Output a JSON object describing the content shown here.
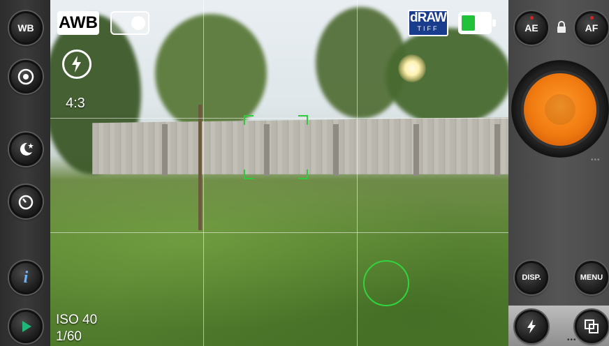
{
  "left_toolbar": {
    "white_balance_label": "WB"
  },
  "overlays": {
    "awb_label": "AWB",
    "aspect_ratio": "4:3",
    "iso_label": "ISO 40",
    "shutter_speed": "1/60"
  },
  "badges": {
    "draw_label": "dRAW",
    "tiff_label": "TIFF",
    "battery_level_percent": 50,
    "battery_color": "#21c23a"
  },
  "right_toolbar": {
    "ae_label": "AE",
    "af_label": "AF",
    "disp_label": "DISP.",
    "menu_label": "MENU"
  },
  "colors": {
    "shutter": "#f07a10",
    "focus": "#2ecb3c",
    "awb_background": "#ffffff",
    "draw_badge": "#1a3c8c"
  },
  "icons": [
    "flash-auto-icon",
    "flash-off-icon",
    "stabilizer-icon",
    "night-mode-icon",
    "timer-icon",
    "info-icon",
    "play-icon",
    "lock-icon",
    "multi-shot-icon",
    "toggle-switch-icon"
  ]
}
